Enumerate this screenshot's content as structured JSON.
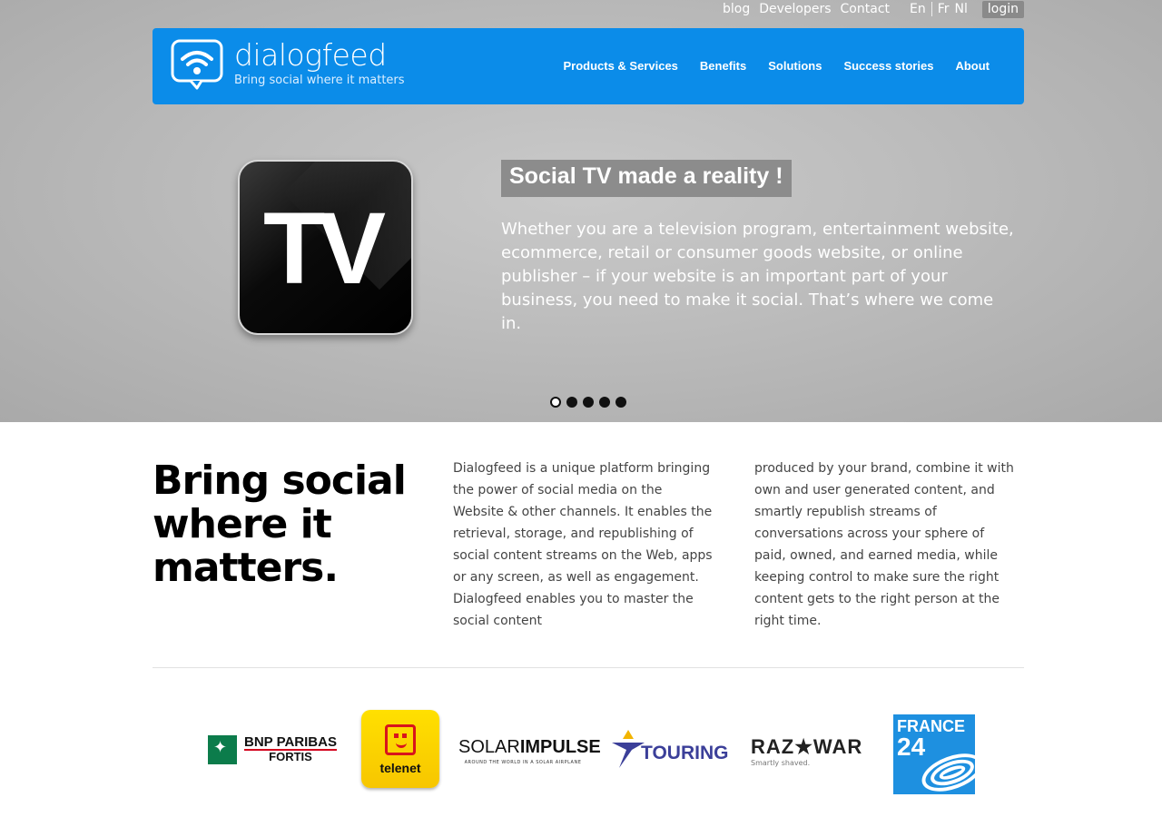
{
  "util_links": {
    "blog": "blog",
    "developers": "Developers",
    "contact": "Contact",
    "lang_en": "En",
    "lang_fr": "Fr",
    "lang_nl": "Nl",
    "login": "login"
  },
  "header": {
    "logo_name": "dialogfeed",
    "logo_tagline": "Bring social where it matters",
    "nav": [
      "Products & Services",
      "Benefits",
      "Solutions",
      "Success stories",
      "About"
    ]
  },
  "slider": {
    "icon_text": "TV",
    "title": "Social TV made a reality !",
    "text": "Whether you are a television program, entertainment website, ecommerce, retail or consumer goods website, or online publisher – if your website is an important part of your business, you need to make it social. That’s where we come in.",
    "slide_count": 5,
    "active_slide": 1
  },
  "intro": {
    "heading": "Bring social where it matters.",
    "col1": "Dialogfeed is a unique platform bringing the power of social media on the Website & other channels. It enables the retrieval, storage, and republishing of social content streams on the Web, apps or any screen, as well as engagement. Dialogfeed enables you to master the social content",
    "col2": "produced by your brand, combine it with own and user generated content, and smartly republish streams of conversations across your sphere of paid, owned, and earned media, while keeping control to make sure the right content gets to the right person at the right time."
  },
  "clients": {
    "bnp_line1": "BNP PARIBAS",
    "bnp_line2": "FORTIS",
    "telenet": "telenet",
    "solar_a": "SOLAR",
    "solar_b": "IMPULSE",
    "solar_tag": "AROUND THE WORLD IN A SOLAR AIRPLANE",
    "touring": "TOURING",
    "razwar": "RAZ★WAR",
    "razwar_tag": "Smartly shaved.",
    "france_a": "FRANCE",
    "france_b": "24"
  },
  "colors": {
    "brand_blue": "#0b8ce9",
    "hero_grey": "#bdbdbd"
  }
}
